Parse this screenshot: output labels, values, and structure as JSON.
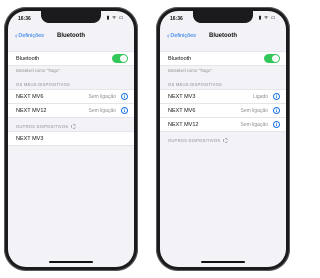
{
  "phones": [
    {
      "status_time": "16:36",
      "status_icons": "▮ ᯤ ▭",
      "nav": {
        "back_label": "Definições",
        "title": "Bluetooth"
      },
      "bluetooth_label": "Bluetooth",
      "bluetooth_on": true,
      "detectable_text": "Detetável como \"Tiago\".",
      "my_devices_header": "OS MEUS DISPOSITIVOS",
      "my_devices": [
        {
          "name": "NEXT MV6",
          "status": "Sem ligação"
        },
        {
          "name": "NEXT MV12",
          "status": "Sem ligação"
        }
      ],
      "other_devices_header": "OUTROS DISPOSITIVOS",
      "other_devices": [
        {
          "name": "NEXT MV3"
        }
      ]
    },
    {
      "status_time": "16:36",
      "status_icons": "▮ ᯤ ▭",
      "nav": {
        "back_label": "Definições",
        "title": "Bluetooth"
      },
      "bluetooth_label": "Bluetooth",
      "bluetooth_on": true,
      "detectable_text": "Detetável como \"Tiago\".",
      "my_devices_header": "OS MEUS DISPOSITIVOS",
      "my_devices": [
        {
          "name": "NEXT MV3",
          "status": "Ligado"
        },
        {
          "name": "NEXT MV6",
          "status": "Sem ligação"
        },
        {
          "name": "NEXT MV12",
          "status": "Sem ligação"
        }
      ],
      "other_devices_header": "OUTROS DISPOSITIVOS",
      "other_devices": []
    }
  ],
  "colors": {
    "accent": "#1a73e8",
    "toggle_on": "#34c759",
    "bg": "#f2f2f7"
  }
}
